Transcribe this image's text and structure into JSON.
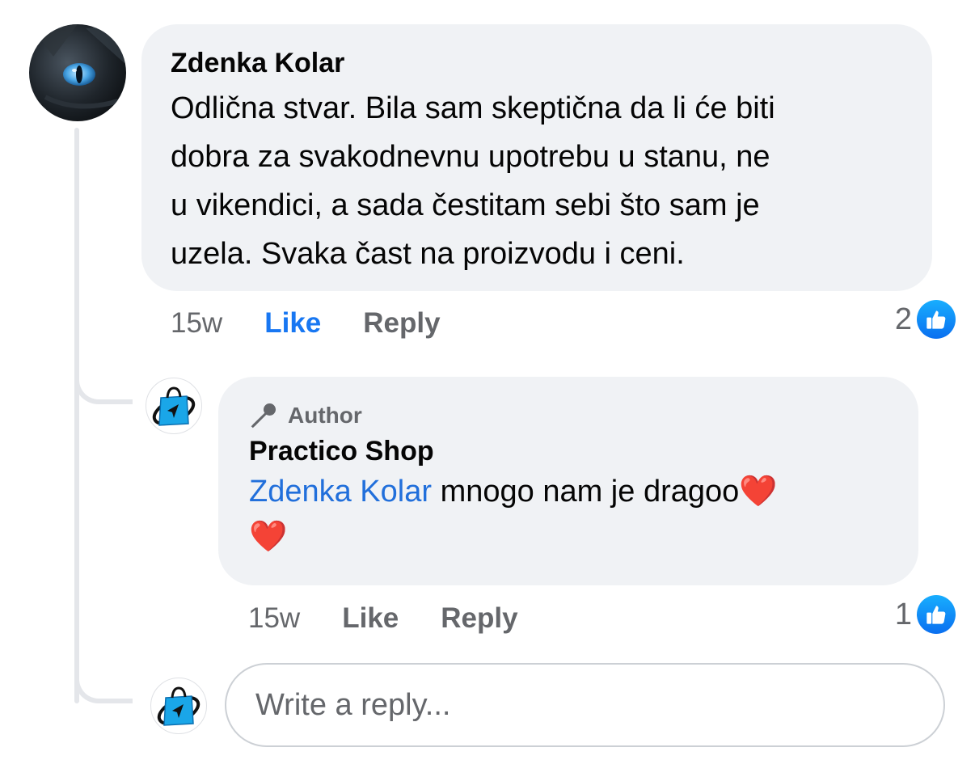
{
  "comment": {
    "author": "Zdenka Kolar",
    "text_lines": [
      "Odlična stvar. Bila sam skeptična da li će biti",
      "dobra za svakodnevnu upotrebu u stanu, ne",
      "u vikendici, a sada čestitam sebi što sam je",
      "uzela. Svaka čast na proizvodu i ceni."
    ],
    "time": "15w",
    "like_label": "Like",
    "reply_label": "Reply",
    "reaction_count": "2",
    "reaction_icon": "thumbs-up-icon",
    "liked": true,
    "accent": "#1877f2"
  },
  "reply": {
    "badge_label": "Author",
    "badge_icon": "microphone-icon",
    "author": "Practico Shop",
    "mention": "Zdenka Kolar",
    "text": "mnogo nam je dragoo❤️",
    "text_line2": "❤️",
    "time": "15w",
    "like_label": "Like",
    "reply_label": "Reply",
    "reaction_count": "1",
    "reaction_icon": "thumbs-up-icon",
    "liked": false
  },
  "composer": {
    "placeholder": "Write a reply..."
  }
}
